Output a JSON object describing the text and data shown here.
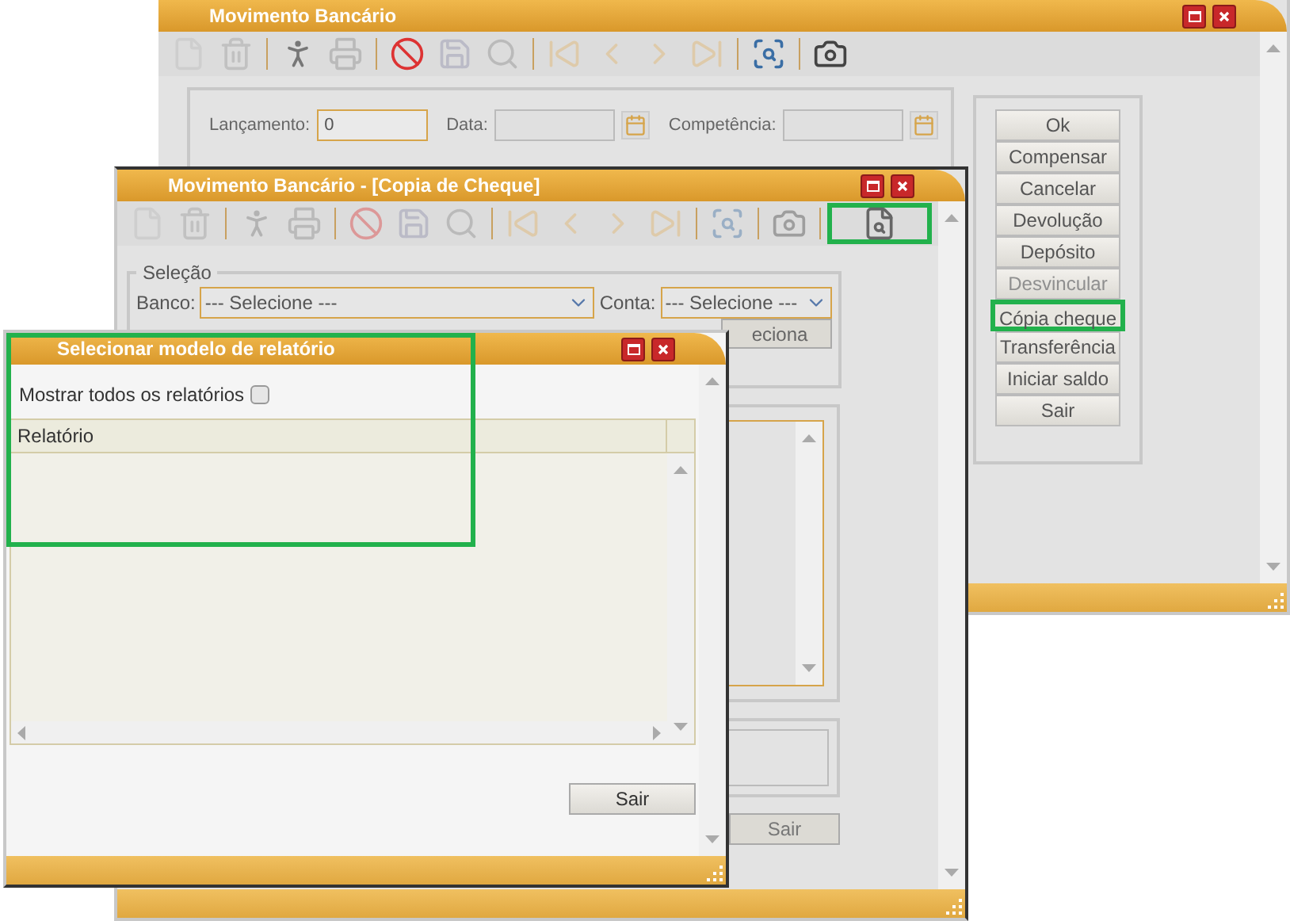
{
  "main_window": {
    "title": "Movimento Bancário",
    "toolbar": [
      {
        "kind": "new",
        "disabled": true,
        "highlighted": false
      },
      {
        "kind": "delete",
        "disabled": true,
        "highlighted": false
      },
      {
        "kind": "run",
        "disabled": false,
        "highlighted": false
      },
      {
        "kind": "print",
        "disabled": true,
        "highlighted": false
      },
      {
        "kind": "cancel",
        "disabled": false,
        "highlighted": false
      },
      {
        "kind": "save",
        "disabled": true,
        "highlighted": false
      },
      {
        "kind": "search",
        "disabled": true,
        "highlighted": false
      },
      {
        "kind": "first",
        "disabled": true,
        "highlighted": false
      },
      {
        "kind": "prev",
        "disabled": true,
        "highlighted": false
      },
      {
        "kind": "next",
        "disabled": true,
        "highlighted": false
      },
      {
        "kind": "last",
        "disabled": true,
        "highlighted": false
      },
      {
        "kind": "report",
        "disabled": false,
        "highlighted": false
      },
      {
        "kind": "camera",
        "disabled": false,
        "highlighted": false
      }
    ],
    "fields": [
      {
        "label": "Lançamento:",
        "kind": "text",
        "value": "0"
      },
      {
        "label": "Data:",
        "kind": "date"
      },
      {
        "label": "Competência:",
        "kind": "date"
      }
    ],
    "buttons": [
      {
        "label": "Ok",
        "disabled": false,
        "highlighted": false
      },
      {
        "label": "Compensar",
        "disabled": false,
        "highlighted": false
      },
      {
        "label": "Cancelar",
        "disabled": false,
        "highlighted": false
      },
      {
        "label": "Devolução",
        "disabled": false,
        "highlighted": false
      },
      {
        "label": "Depósito",
        "disabled": false,
        "highlighted": false
      },
      {
        "label": "Desvincular",
        "disabled": true,
        "highlighted": false
      },
      {
        "label": "Cópia cheque",
        "disabled": false,
        "highlighted": true
      },
      {
        "label": "Transferência",
        "disabled": false,
        "highlighted": false
      },
      {
        "label": "Iniciar saldo",
        "disabled": false,
        "highlighted": false
      },
      {
        "label": "Sair",
        "disabled": false,
        "highlighted": false
      }
    ]
  },
  "check_window": {
    "title": "Movimento Bancário - [Copia de Cheque]",
    "toolbar": [
      {
        "kind": "new",
        "disabled": true,
        "highlighted": false
      },
      {
        "kind": "delete",
        "disabled": true,
        "highlighted": false
      },
      {
        "kind": "run",
        "disabled": true,
        "highlighted": false
      },
      {
        "kind": "print",
        "disabled": true,
        "highlighted": false
      },
      {
        "kind": "cancel",
        "disabled": true,
        "highlighted": false
      },
      {
        "kind": "save",
        "disabled": true,
        "highlighted": false
      },
      {
        "kind": "search",
        "disabled": true,
        "highlighted": false
      },
      {
        "kind": "first",
        "disabled": true,
        "highlighted": false
      },
      {
        "kind": "prev",
        "disabled": true,
        "highlighted": false
      },
      {
        "kind": "next",
        "disabled": true,
        "highlighted": false
      },
      {
        "kind": "last",
        "disabled": true,
        "highlighted": false
      },
      {
        "kind": "report",
        "disabled": true,
        "highlighted": false
      },
      {
        "kind": "camera",
        "disabled": true,
        "highlighted": false
      },
      {
        "kind": "check-search",
        "disabled": false,
        "highlighted": true
      }
    ],
    "section": {
      "legend": "Seleção",
      "fields": [
        {
          "label": "Banco:",
          "kind": "select",
          "value": "--- Selecione ---"
        },
        {
          "label": "Conta:",
          "kind": "select",
          "value": "--- Selecione ---"
        }
      ]
    },
    "partial_button": "eciona",
    "exit_button": "Sair"
  },
  "report_dialog": {
    "title": "Selecionar modelo de relatório",
    "highlighted": true,
    "checkbox": {
      "label": "Mostrar todos os relatórios",
      "checked": false
    },
    "table": {
      "columns": [
        "Relatório"
      ]
    },
    "exit_button": "Sair"
  }
}
